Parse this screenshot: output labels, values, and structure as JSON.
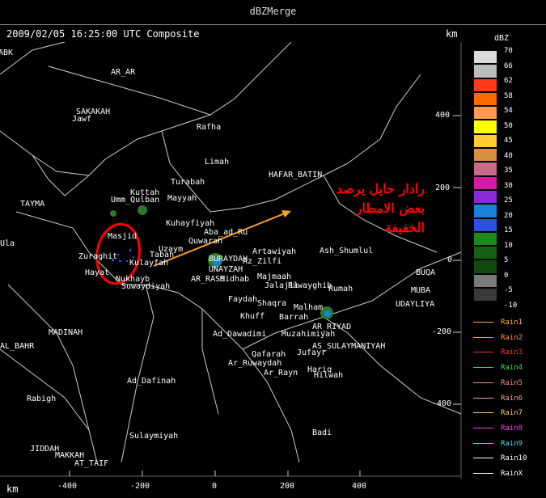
{
  "window": {
    "title": "dBZMerge"
  },
  "header": {
    "timestamp": "2009/02/05 16:25:00 UTC Composite",
    "km_top": "km",
    "km_bottom": "km"
  },
  "legend": {
    "title": "dBZ",
    "scale": [
      {
        "label": "70",
        "color": "#dcdcdc"
      },
      {
        "label": "66",
        "color": "#bdbdbd"
      },
      {
        "label": "62",
        "color": "#ff3a1a"
      },
      {
        "label": "58",
        "color": "#ff6a00"
      },
      {
        "label": "54",
        "color": "#ff9a50"
      },
      {
        "label": "50",
        "color": "#ffff00"
      },
      {
        "label": "45",
        "color": "#ffcc33"
      },
      {
        "label": "40",
        "color": "#d8903c"
      },
      {
        "label": "35",
        "color": "#c86a8c"
      },
      {
        "label": "30",
        "color": "#d41aa6"
      },
      {
        "label": "25",
        "color": "#8a2ad6"
      },
      {
        "label": "20",
        "color": "#1a82dc"
      },
      {
        "label": "15",
        "color": "#2a50e8"
      },
      {
        "label": "10",
        "color": "#1a8a1a"
      },
      {
        "label": "5",
        "color": "#166016"
      },
      {
        "label": "0",
        "color": "#124a12"
      },
      {
        "label": "-5",
        "color": "#7a7a7a"
      },
      {
        "label": "-10",
        "color": "#3a3a3a"
      }
    ],
    "rain": [
      {
        "label": "Rain1",
        "color": "#ffb040"
      },
      {
        "label": "Rain2",
        "color": "#ff9a40"
      },
      {
        "label": "Rain3",
        "color": "#ff3030"
      },
      {
        "label": "Rain4",
        "color": "#40e040"
      },
      {
        "label": "Rain5",
        "color": "#ff8a8a"
      },
      {
        "label": "Rain6",
        "color": "#ff9aa0"
      },
      {
        "label": "Rain7",
        "color": "#ffd060"
      },
      {
        "label": "Rain8",
        "color": "#ff40ff"
      },
      {
        "label": "Rain9",
        "color": "#40e0ff"
      },
      {
        "label": "Rain10",
        "color": "#ffffff"
      },
      {
        "label": "RainX",
        "color": "#ffffff"
      }
    ]
  },
  "axes": {
    "x_ticks": [
      "-400",
      "-200",
      "0",
      "200",
      "400"
    ],
    "y_ticks": [
      "400",
      "200",
      "0",
      "-200",
      "-400"
    ]
  },
  "annotation": {
    "line1": "رادار حايل يرصد",
    "line2": "بعض الامطار",
    "line3": "الخفيفة"
  },
  "cities": [
    {
      "name": "ABK"
    },
    {
      "name": "AR_AR"
    },
    {
      "name": "SAKAKAH"
    },
    {
      "name": "Jawf"
    },
    {
      "name": "Rafha"
    },
    {
      "name": "Limah"
    },
    {
      "name": "HAFAR_BATIN"
    },
    {
      "name": "Turabah"
    },
    {
      "name": "Kuttah"
    },
    {
      "name": "Umm_Qulban"
    },
    {
      "name": "Mayyah"
    },
    {
      "name": "TAYMA"
    },
    {
      "name": "Kuhayfiyah"
    },
    {
      "name": "Masjid"
    },
    {
      "name": "Uzaym"
    },
    {
      "name": "Aba_ad_Ru"
    },
    {
      "name": "Quwarah"
    },
    {
      "name": "Artawiyah"
    },
    {
      "name": "Ash_Shumlul"
    },
    {
      "name": "Ula"
    },
    {
      "name": "Zuraghit"
    },
    {
      "name": "Kulayfah"
    },
    {
      "name": "Tabah"
    },
    {
      "name": "BURAYDAH"
    },
    {
      "name": "Az_Zilfi"
    },
    {
      "name": "UNAYZAH"
    },
    {
      "name": "AR_RASS"
    },
    {
      "name": "Midhab"
    },
    {
      "name": "Hayat"
    },
    {
      "name": "Nukhayb"
    },
    {
      "name": "Suwaydiyah"
    },
    {
      "name": "Majmaah"
    },
    {
      "name": "Jalajil"
    },
    {
      "name": "Ruwayghib"
    },
    {
      "name": "Rumah"
    },
    {
      "name": "Faydah"
    },
    {
      "name": "Shaqra"
    },
    {
      "name": "Khuff"
    },
    {
      "name": "Barrah"
    },
    {
      "name": "Malham"
    },
    {
      "name": "AR_RIYAD"
    },
    {
      "name": "MADINAH"
    },
    {
      "name": "Ad_Dawadimi"
    },
    {
      "name": "Muzahimiyah"
    },
    {
      "name": "AL_BAHR"
    },
    {
      "name": "AS_SULAYMANIYAH"
    },
    {
      "name": "Qafarah"
    },
    {
      "name": "Jufayr"
    },
    {
      "name": "Ar_Ruwaydah"
    },
    {
      "name": "Hariq"
    },
    {
      "name": "Ar_Rayn"
    },
    {
      "name": "Hilwah"
    },
    {
      "name": "Ad_Dafinah"
    },
    {
      "name": "Rabigh"
    },
    {
      "name": "Sulaymiyah"
    },
    {
      "name": "Badi"
    },
    {
      "name": "JIDDAH"
    },
    {
      "name": "MAKKAH"
    },
    {
      "name": "AT_TAIF"
    },
    {
      "name": "BUQA"
    },
    {
      "name": "UDAYLIYA"
    },
    {
      "name": "MUBA"
    }
  ]
}
